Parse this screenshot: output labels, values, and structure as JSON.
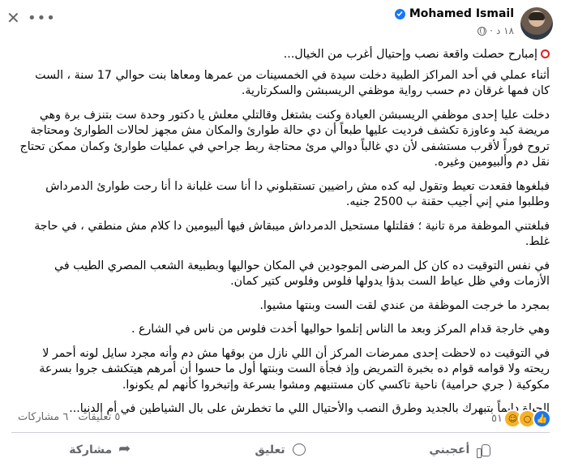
{
  "header": {
    "author_name": "Mohamed Ismail",
    "time": "١٨ د",
    "privacy_icon": "globe-icon",
    "more_icon": "more-options-icon",
    "close_icon": "close-icon"
  },
  "post": {
    "paragraphs": [
      "إمبارح حصلت واقعة نصب وإحتيال أغرب من الخيال...",
      "أثناء عملي في أحد المراكز الطبية دخلت سيدة في الخمسينات من عمرها ومعاها بنت حوالي 17 سنة ، الست كان فمها غرقان دم حسب رواية موظفي الريسبشن والسكرتارية.",
      "دخلت عليا إحدى موظفي الريسبشن العيادة وكنت بشتغل وقالتلي معلش يا دكتور وحدة ست بتنزف برة وهي مريضة كبد وعاوزة تكشف فرديت عليها طبعاً أن دي حالة طوارئ  والمكان مش مجهز لحالات الطوارئ ومحتاجة تروح فوراً لأقرب مستشفى لأن دي غالباً دوالي مرئ محتاجة ربط جراحي في عمليات طوارئ وكمان ممكن تحتاج نقل دم وألبيومين وغيره.",
      "فبلغوها فقعدت تعيط وتقول ليه كده مش راضيين تستقبلوني دا أنا ست غلبانة دا أنا رحت طوارئ الدمرداش وطلبوا مني إني أجيب حقنة ب 2500 جنيه.",
      "فبلغتني الموظفة مرة تانية ؛ فقلتلها مستحيل الدمرداش ميبقاش فيها ألبيومين دا كلام مش منطقي ، في حاجة غلط.",
      "في نفس التوقيت ده كان كل المرضى الموجودين في المكان حواليها وبطبيعة الشعب المصري الطيب في الأزمات وفي ظل عياط الست بدؤا يدولها فلوس وفلوس كتير كمان.",
      "بمجرد ما خرجت الموظفة من عندي لقت الست وبنتها  مشيوا.",
      "وهي خارجة قدام المركز وبعد ما الناس إتلموا حواليها أخدت فلوس من ناس في الشارع .",
      "في التوقيت ده  لاحظت إحدى ممرضات المركز أن اللي نازل من بوقها مش دم وأنه مجرد سايل لونه أحمر  لا ريحته ولا قوامه قوام ده بخبرة التمريض وإذ فجأة الست وبنتها أول ما حسوا أن أمرهم هيتكشف جروا بسرعة مكوكية ( جري حرامية) ناحية تاكسي كان مستنيهم ومشوا بسرعة وإتبخروا كأنهم لم يكونوا.",
      "الحياة دايماً بتبهرك بالجديد وطرق النصب والأحتيال اللي ما تخطرش على بال الشياطين في أم الدنيا..."
    ]
  },
  "stats": {
    "reaction_count": "٥١",
    "comments": "٥ تعليقات",
    "shares": "٦ مشاركات"
  },
  "actions": {
    "like_label": "أعجبني",
    "comment_label": "تعليق",
    "share_label": "مشاركة"
  },
  "colors": {
    "verified": "#1877f2",
    "secondary_text": "#65676b",
    "red_circle": "#e02020"
  }
}
